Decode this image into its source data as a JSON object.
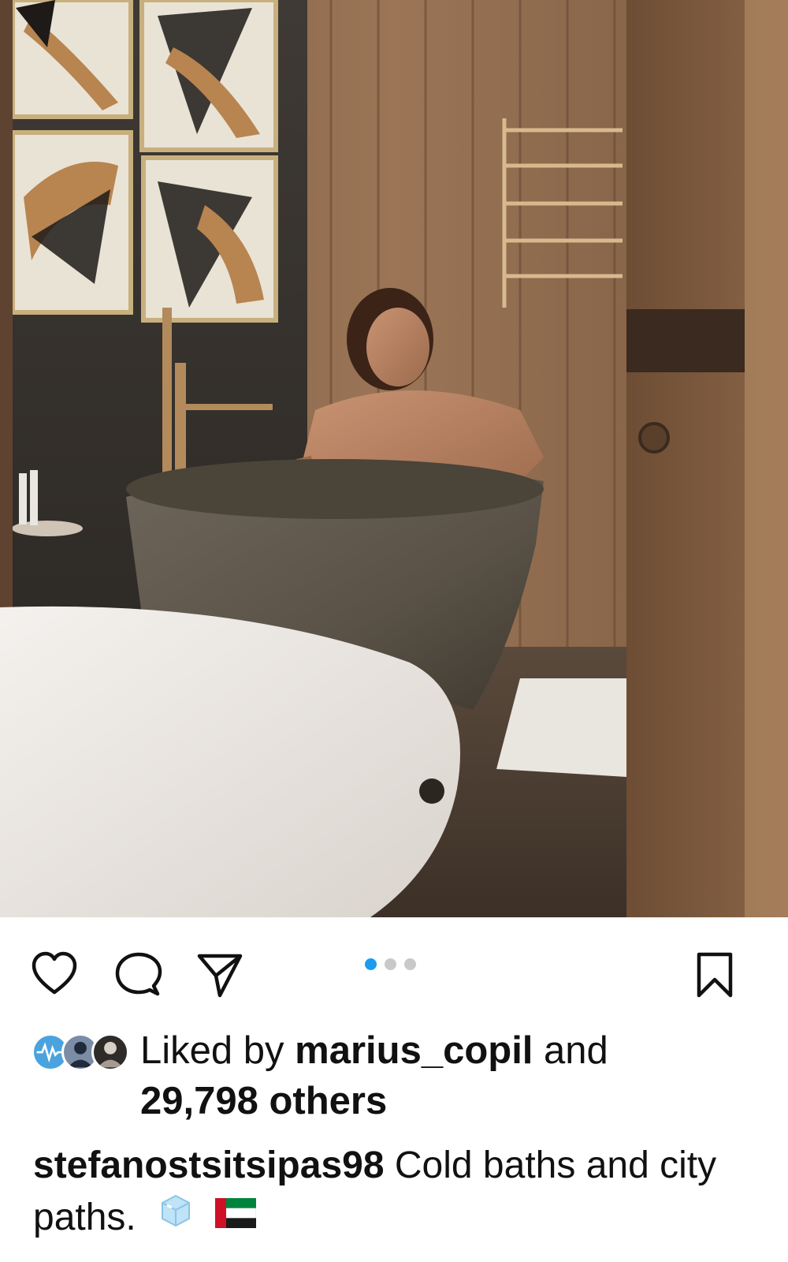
{
  "post": {
    "image_alt": "Man smiling in a freestanding bathtub in a wood-paneled hotel bathroom",
    "carousel": {
      "count": 3,
      "active_index": 0
    }
  },
  "actions": {
    "like_icon": "heart-icon",
    "comment_icon": "comment-icon",
    "share_icon": "send-icon",
    "save_icon": "bookmark-icon"
  },
  "likes": {
    "prefix": "Liked by",
    "user": "marius_copil",
    "conjunction": "and",
    "others": "29,798 others"
  },
  "caption": {
    "username": "stefanostsitsipas98",
    "text": "Cold baths and city paths.",
    "emojis": [
      "ice-cube-emoji",
      "uae-flag-emoji"
    ]
  },
  "colors": {
    "accent_dot": "#1d9bf0",
    "inactive_dot": "#c9c9c9",
    "text": "#111111"
  }
}
